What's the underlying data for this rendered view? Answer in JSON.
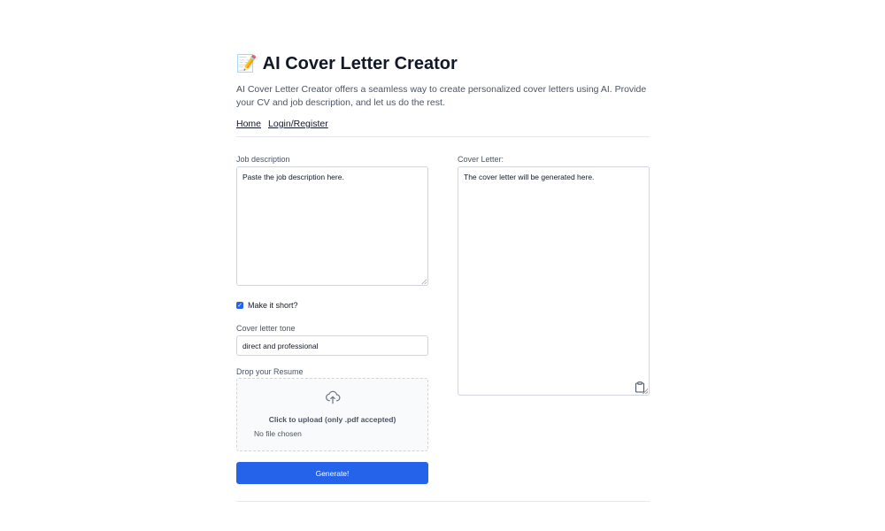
{
  "header": {
    "emoji": "📝",
    "title": "AI Cover Letter Creator",
    "description": "AI Cover Letter Creator offers a seamless way to create personalized cover letters using AI. Provide your CV and job description, and let us do the rest."
  },
  "nav": {
    "home": "Home",
    "login": "Login/Register"
  },
  "form": {
    "job_description_label": "Job description",
    "job_description_placeholder": "Paste the job description here.",
    "short_label": "Make it short?",
    "short_checked": true,
    "tone_label": "Cover letter tone",
    "tone_value": "direct and professional",
    "resume_label": "Drop your Resume",
    "upload_text": "Click to upload (only .pdf accepted)",
    "file_status": "No file chosen",
    "generate_label": "Generate!"
  },
  "output": {
    "cover_letter_label": "Cover Letter:",
    "cover_letter_placeholder": "The cover letter will be generated here."
  },
  "colors": {
    "accent": "#2563eb",
    "border": "#d1d5db",
    "muted_text": "#4b5563"
  }
}
